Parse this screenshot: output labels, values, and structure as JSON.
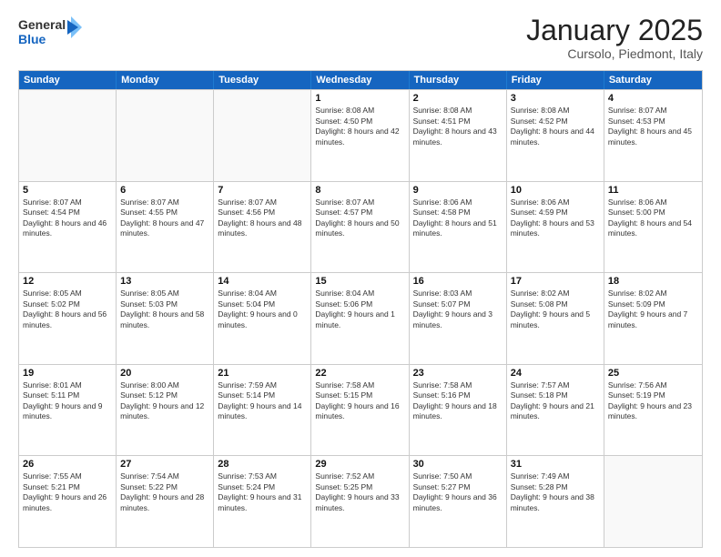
{
  "header": {
    "logo": {
      "line1": "General",
      "line2": "Blue"
    },
    "title": "January 2025",
    "location": "Cursolo, Piedmont, Italy"
  },
  "weekdays": [
    "Sunday",
    "Monday",
    "Tuesday",
    "Wednesday",
    "Thursday",
    "Friday",
    "Saturday"
  ],
  "weeks": [
    [
      {
        "day": "",
        "sunrise": "",
        "sunset": "",
        "daylight": ""
      },
      {
        "day": "",
        "sunrise": "",
        "sunset": "",
        "daylight": ""
      },
      {
        "day": "",
        "sunrise": "",
        "sunset": "",
        "daylight": ""
      },
      {
        "day": "1",
        "sunrise": "Sunrise: 8:08 AM",
        "sunset": "Sunset: 4:50 PM",
        "daylight": "Daylight: 8 hours and 42 minutes."
      },
      {
        "day": "2",
        "sunrise": "Sunrise: 8:08 AM",
        "sunset": "Sunset: 4:51 PM",
        "daylight": "Daylight: 8 hours and 43 minutes."
      },
      {
        "day": "3",
        "sunrise": "Sunrise: 8:08 AM",
        "sunset": "Sunset: 4:52 PM",
        "daylight": "Daylight: 8 hours and 44 minutes."
      },
      {
        "day": "4",
        "sunrise": "Sunrise: 8:07 AM",
        "sunset": "Sunset: 4:53 PM",
        "daylight": "Daylight: 8 hours and 45 minutes."
      }
    ],
    [
      {
        "day": "5",
        "sunrise": "Sunrise: 8:07 AM",
        "sunset": "Sunset: 4:54 PM",
        "daylight": "Daylight: 8 hours and 46 minutes."
      },
      {
        "day": "6",
        "sunrise": "Sunrise: 8:07 AM",
        "sunset": "Sunset: 4:55 PM",
        "daylight": "Daylight: 8 hours and 47 minutes."
      },
      {
        "day": "7",
        "sunrise": "Sunrise: 8:07 AM",
        "sunset": "Sunset: 4:56 PM",
        "daylight": "Daylight: 8 hours and 48 minutes."
      },
      {
        "day": "8",
        "sunrise": "Sunrise: 8:07 AM",
        "sunset": "Sunset: 4:57 PM",
        "daylight": "Daylight: 8 hours and 50 minutes."
      },
      {
        "day": "9",
        "sunrise": "Sunrise: 8:06 AM",
        "sunset": "Sunset: 4:58 PM",
        "daylight": "Daylight: 8 hours and 51 minutes."
      },
      {
        "day": "10",
        "sunrise": "Sunrise: 8:06 AM",
        "sunset": "Sunset: 4:59 PM",
        "daylight": "Daylight: 8 hours and 53 minutes."
      },
      {
        "day": "11",
        "sunrise": "Sunrise: 8:06 AM",
        "sunset": "Sunset: 5:00 PM",
        "daylight": "Daylight: 8 hours and 54 minutes."
      }
    ],
    [
      {
        "day": "12",
        "sunrise": "Sunrise: 8:05 AM",
        "sunset": "Sunset: 5:02 PM",
        "daylight": "Daylight: 8 hours and 56 minutes."
      },
      {
        "day": "13",
        "sunrise": "Sunrise: 8:05 AM",
        "sunset": "Sunset: 5:03 PM",
        "daylight": "Daylight: 8 hours and 58 minutes."
      },
      {
        "day": "14",
        "sunrise": "Sunrise: 8:04 AM",
        "sunset": "Sunset: 5:04 PM",
        "daylight": "Daylight: 9 hours and 0 minutes."
      },
      {
        "day": "15",
        "sunrise": "Sunrise: 8:04 AM",
        "sunset": "Sunset: 5:06 PM",
        "daylight": "Daylight: 9 hours and 1 minute."
      },
      {
        "day": "16",
        "sunrise": "Sunrise: 8:03 AM",
        "sunset": "Sunset: 5:07 PM",
        "daylight": "Daylight: 9 hours and 3 minutes."
      },
      {
        "day": "17",
        "sunrise": "Sunrise: 8:02 AM",
        "sunset": "Sunset: 5:08 PM",
        "daylight": "Daylight: 9 hours and 5 minutes."
      },
      {
        "day": "18",
        "sunrise": "Sunrise: 8:02 AM",
        "sunset": "Sunset: 5:09 PM",
        "daylight": "Daylight: 9 hours and 7 minutes."
      }
    ],
    [
      {
        "day": "19",
        "sunrise": "Sunrise: 8:01 AM",
        "sunset": "Sunset: 5:11 PM",
        "daylight": "Daylight: 9 hours and 9 minutes."
      },
      {
        "day": "20",
        "sunrise": "Sunrise: 8:00 AM",
        "sunset": "Sunset: 5:12 PM",
        "daylight": "Daylight: 9 hours and 12 minutes."
      },
      {
        "day": "21",
        "sunrise": "Sunrise: 7:59 AM",
        "sunset": "Sunset: 5:14 PM",
        "daylight": "Daylight: 9 hours and 14 minutes."
      },
      {
        "day": "22",
        "sunrise": "Sunrise: 7:58 AM",
        "sunset": "Sunset: 5:15 PM",
        "daylight": "Daylight: 9 hours and 16 minutes."
      },
      {
        "day": "23",
        "sunrise": "Sunrise: 7:58 AM",
        "sunset": "Sunset: 5:16 PM",
        "daylight": "Daylight: 9 hours and 18 minutes."
      },
      {
        "day": "24",
        "sunrise": "Sunrise: 7:57 AM",
        "sunset": "Sunset: 5:18 PM",
        "daylight": "Daylight: 9 hours and 21 minutes."
      },
      {
        "day": "25",
        "sunrise": "Sunrise: 7:56 AM",
        "sunset": "Sunset: 5:19 PM",
        "daylight": "Daylight: 9 hours and 23 minutes."
      }
    ],
    [
      {
        "day": "26",
        "sunrise": "Sunrise: 7:55 AM",
        "sunset": "Sunset: 5:21 PM",
        "daylight": "Daylight: 9 hours and 26 minutes."
      },
      {
        "day": "27",
        "sunrise": "Sunrise: 7:54 AM",
        "sunset": "Sunset: 5:22 PM",
        "daylight": "Daylight: 9 hours and 28 minutes."
      },
      {
        "day": "28",
        "sunrise": "Sunrise: 7:53 AM",
        "sunset": "Sunset: 5:24 PM",
        "daylight": "Daylight: 9 hours and 31 minutes."
      },
      {
        "day": "29",
        "sunrise": "Sunrise: 7:52 AM",
        "sunset": "Sunset: 5:25 PM",
        "daylight": "Daylight: 9 hours and 33 minutes."
      },
      {
        "day": "30",
        "sunrise": "Sunrise: 7:50 AM",
        "sunset": "Sunset: 5:27 PM",
        "daylight": "Daylight: 9 hours and 36 minutes."
      },
      {
        "day": "31",
        "sunrise": "Sunrise: 7:49 AM",
        "sunset": "Sunset: 5:28 PM",
        "daylight": "Daylight: 9 hours and 38 minutes."
      },
      {
        "day": "",
        "sunrise": "",
        "sunset": "",
        "daylight": ""
      }
    ]
  ]
}
